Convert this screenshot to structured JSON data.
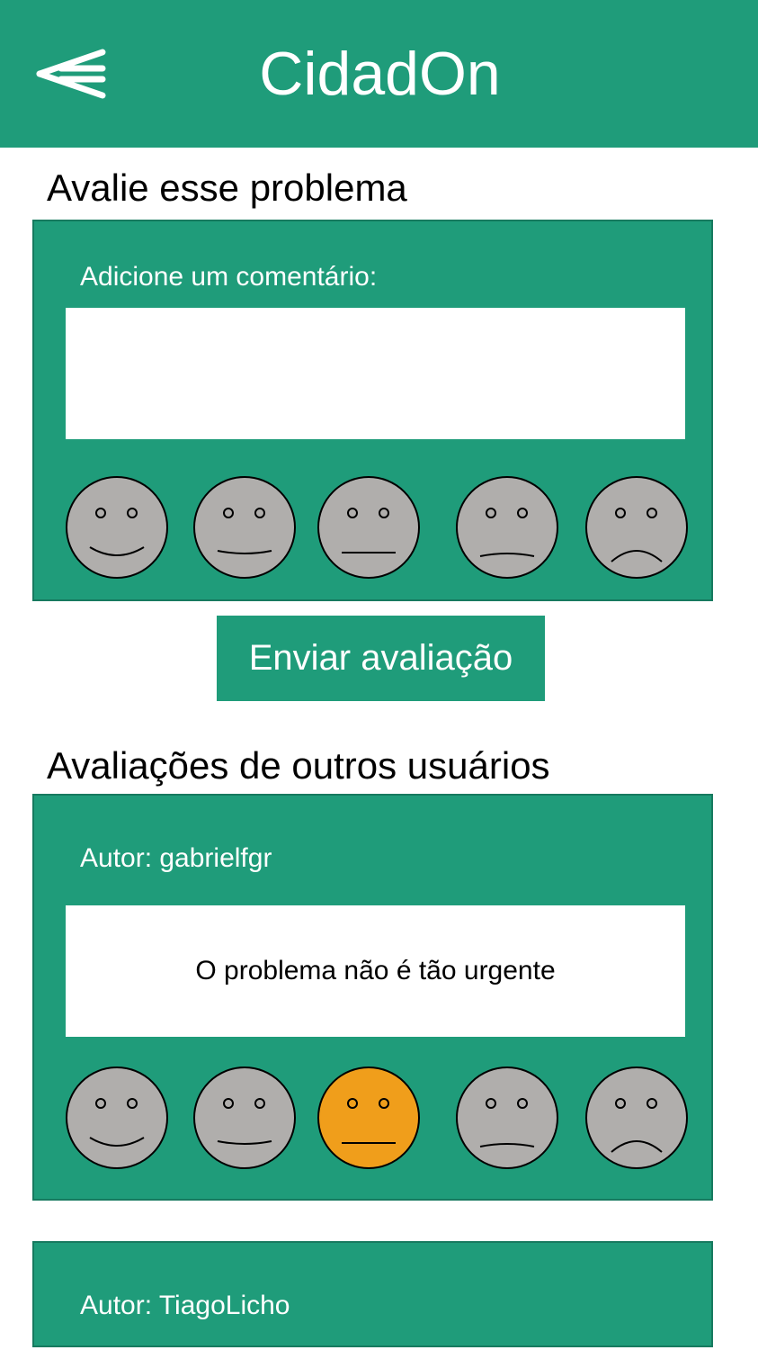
{
  "header": {
    "title": "CidadOn",
    "back_icon": "back-arrow-icon",
    "color": "#1f9c7a"
  },
  "rate_section": {
    "title": "Avalie esse problema",
    "comment_label": "Adicione um comentário:",
    "comment_value": "",
    "ratings": [
      "very-happy-face-icon",
      "happy-face-icon",
      "neutral-face-icon",
      "sad-face-icon",
      "very-sad-face-icon"
    ],
    "selected": null
  },
  "submit": {
    "label": "Enviar avaliação"
  },
  "others_section": {
    "title": "Avaliações de outros usuários",
    "reviews": [
      {
        "author_label": "Autor: gabrielfgr",
        "comment": "O problema não é tão urgente",
        "selected_rating_index": 2
      },
      {
        "author_label": "Autor: TiagoLicho"
      }
    ]
  },
  "colors": {
    "brand": "#1f9c7a",
    "face_default": "#b0aeac",
    "face_selected": "#f09e1b"
  }
}
